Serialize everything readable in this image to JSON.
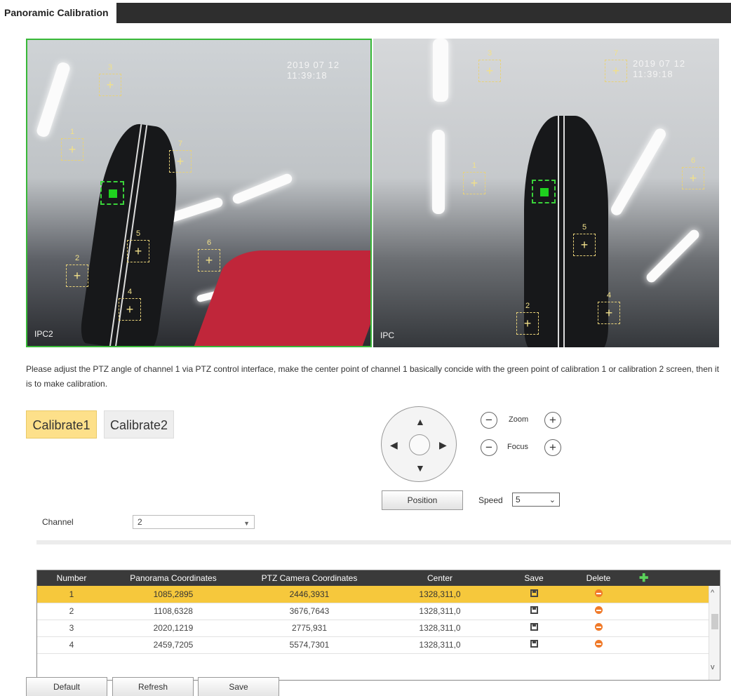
{
  "title": "Panoramic Calibration",
  "video_left": {
    "timestamp": "2019 07 12 11:39:18",
    "channel_label": "IPC2",
    "markers": [
      "1",
      "2",
      "3",
      "4",
      "5",
      "6",
      "7"
    ]
  },
  "video_right": {
    "timestamp": "2019 07 12 11:39:18",
    "channel_label": "IPC",
    "markers": [
      "1",
      "2",
      "3",
      "4",
      "5",
      "6",
      "7"
    ]
  },
  "instruction": "Please adjust the PTZ angle of channel 1 via PTZ control interface, make the center point of channel 1 basically concide with the green point of calibration 1 or calibration 2 screen, then it is to make calibration.",
  "calibrate_tabs": [
    "Calibrate1",
    "Calibrate2"
  ],
  "ptz": {
    "zoom_label": "Zoom",
    "focus_label": "Focus",
    "minus": "−",
    "plus": "+",
    "position_button": "Position",
    "speed_label": "Speed",
    "speed_value": "5"
  },
  "channel": {
    "label": "Channel",
    "value": "2"
  },
  "table": {
    "headers": [
      "Number",
      "Panorama Coordinates",
      "PTZ Camera Coordinates",
      "Center",
      "Save",
      "Delete"
    ],
    "rows": [
      {
        "number": "1",
        "panorama": "1085,2895",
        "ptz": "2446,3931",
        "center": "1328,311,0"
      },
      {
        "number": "2",
        "panorama": "1108,6328",
        "ptz": "3676,7643",
        "center": "1328,311,0"
      },
      {
        "number": "3",
        "panorama": "2020,1219",
        "ptz": "2775,931",
        "center": "1328,311,0"
      },
      {
        "number": "4",
        "panorama": "2459,7205",
        "ptz": "5574,7301",
        "center": "1328,311,0"
      }
    ]
  },
  "buttons": {
    "default": "Default",
    "refresh": "Refresh",
    "save": "Save"
  },
  "icons": {
    "up": "▲",
    "down": "▼",
    "left": "◀",
    "right": "▶",
    "chevron": "⌄",
    "add": "✚",
    "scroll_up": "^",
    "scroll_down": "v"
  }
}
